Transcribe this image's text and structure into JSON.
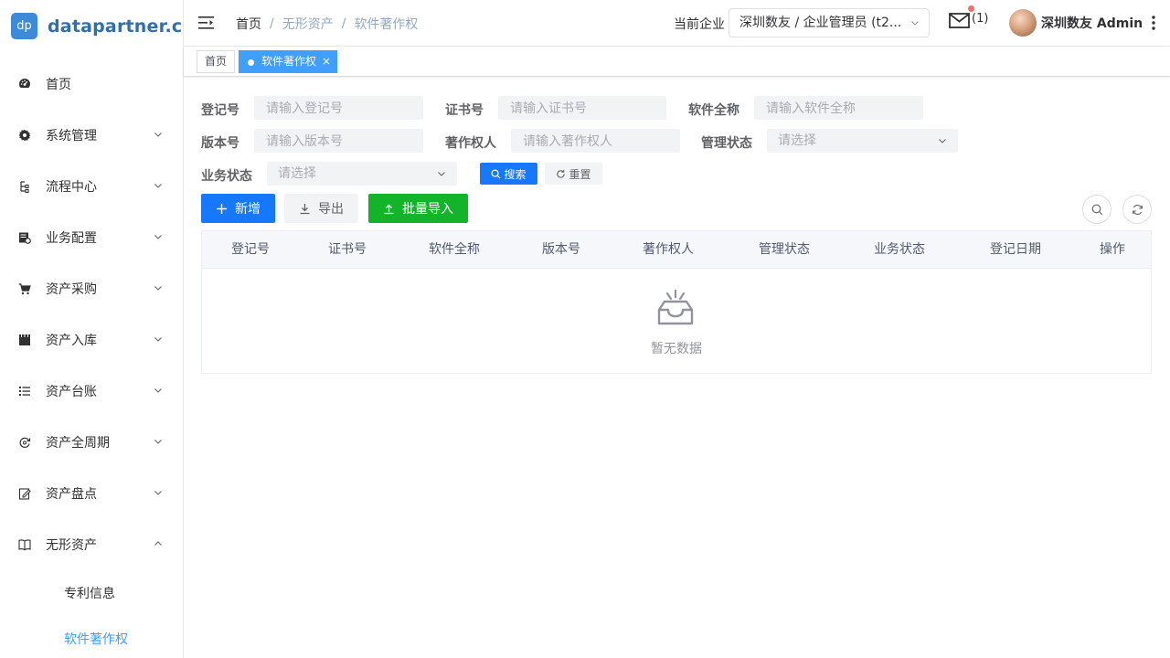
{
  "logo": {
    "badge": "dp",
    "site": "datapartner.cn"
  },
  "sidebar": {
    "items": [
      {
        "label": "首页",
        "icon": "dashboard-icon",
        "expandable": false
      },
      {
        "label": "系统管理",
        "icon": "gear-icon",
        "expandable": true
      },
      {
        "label": "流程中心",
        "icon": "flow-icon",
        "expandable": true
      },
      {
        "label": "业务配置",
        "icon": "config-icon",
        "expandable": true
      },
      {
        "label": "资产采购",
        "icon": "cart-icon",
        "expandable": true
      },
      {
        "label": "资产入库",
        "icon": "warehouse-icon",
        "expandable": true
      },
      {
        "label": "资产台账",
        "icon": "list-icon",
        "expandable": true
      },
      {
        "label": "资产全周期",
        "icon": "cycle-icon",
        "expandable": true
      },
      {
        "label": "资产盘点",
        "icon": "edit-icon",
        "expandable": true
      },
      {
        "label": "无形资产",
        "icon": "book-icon",
        "expandable": true,
        "expanded": true
      }
    ],
    "subitems": [
      {
        "label": "专利信息",
        "active": false
      },
      {
        "label": "软件著作权",
        "active": true
      }
    ]
  },
  "header": {
    "breadcrumb": [
      "首页",
      "无形资产",
      "软件著作权"
    ],
    "breadcrumb_sep": "/",
    "company_label": "当前企业",
    "company_value": "深圳数友 / 企业管理员 (t2...",
    "mail_count": "(1)",
    "username": "深圳数友 Admin"
  },
  "tags": {
    "home": "首页",
    "active": "软件著作权",
    "close": "×"
  },
  "form": {
    "reg_no_label": "登记号",
    "reg_no_placeholder": "请输入登记号",
    "cert_no_label": "证书号",
    "cert_no_placeholder": "请输入证书号",
    "soft_name_label": "软件全称",
    "soft_name_placeholder": "请输入软件全称",
    "version_label": "版本号",
    "version_placeholder": "请输入版本号",
    "owner_label": "著作权人",
    "owner_placeholder": "请输入著作权人",
    "manage_status_label": "管理状态",
    "manage_status_placeholder": "请选择",
    "biz_status_label": "业务状态",
    "biz_status_placeholder": "请选择",
    "search_btn": "搜索",
    "reset_btn": "重置"
  },
  "toolbar": {
    "add": "新增",
    "export": "导出",
    "import": "批量导入"
  },
  "table": {
    "columns": [
      "登记号",
      "证书号",
      "软件全称",
      "版本号",
      "著作权人",
      "管理状态",
      "业务状态",
      "登记日期",
      "操作"
    ],
    "empty_text": "暂无数据"
  },
  "colors": {
    "primary": "#1677ff",
    "active_tag": "#409eff",
    "import_green": "#13b42a",
    "notify_red": "#f56c6c"
  }
}
